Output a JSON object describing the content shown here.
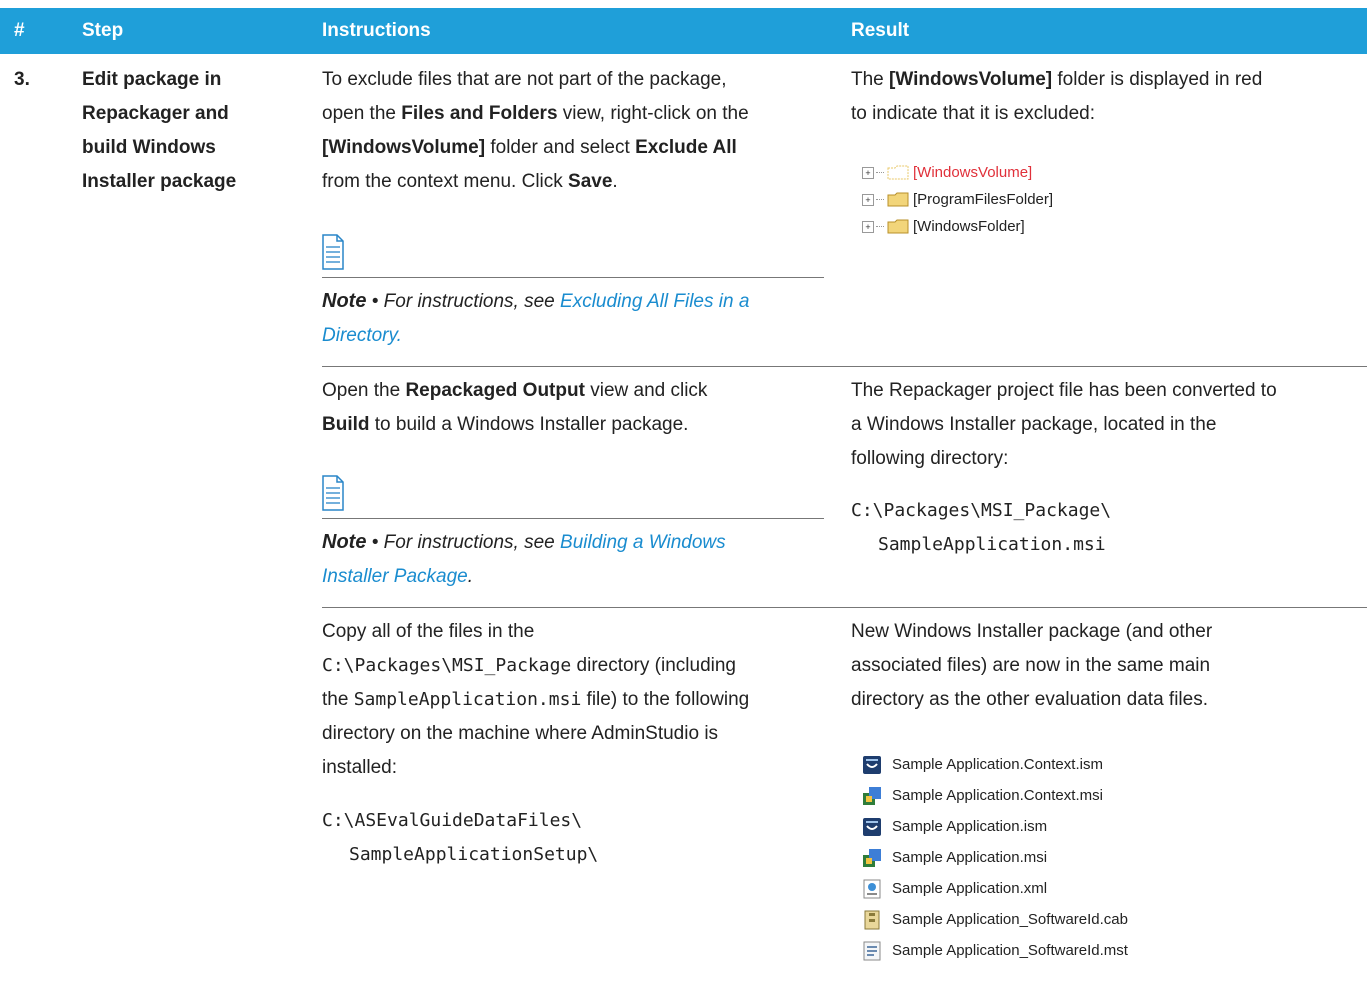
{
  "header": {
    "num": "#",
    "step": "Step",
    "instructions": "Instructions",
    "result": "Result"
  },
  "row1": {
    "number": "3.",
    "step": [
      "Edit package in",
      "Repackager and",
      "build Windows",
      "Installer package"
    ],
    "instr": {
      "l1": "To exclude files that are not part of the package,",
      "l2_a": "open the ",
      "l2_b": "Files and Folders",
      "l2_c": " view, right-click on the",
      "l3_a": "[WindowsVolume]",
      "l3_b": " folder and select ",
      "l3_c": "Exclude All",
      "l4_a": "from the context menu. Click ",
      "l4_b": "Save",
      "l4_c": "."
    },
    "note": {
      "label": "Note",
      "bullet": " • ",
      "text": "For instructions, see ",
      "link1": "Excluding All Files in a",
      "link2": "Directory.",
      "icon": "note-icon"
    },
    "result": {
      "l1_a": "The ",
      "l1_b": "[WindowsVolume]",
      "l1_c": " folder is displayed in red",
      "l2": "to indicate that it is excluded:"
    },
    "tree": [
      "[WindowsVolume]",
      "[ProgramFilesFolder]",
      "[WindowsFolder]"
    ]
  },
  "row2": {
    "instr": {
      "l1_a": "Open the ",
      "l1_b": "Repackaged Output",
      "l1_c": " view and click",
      "l2_a": "Build",
      "l2_b": " to build a Windows Installer package."
    },
    "note": {
      "label": "Note",
      "bullet": " • ",
      "text": "For instructions, see ",
      "link1": "Building a Windows",
      "link2": "Installer Package",
      "end": "."
    },
    "result": {
      "l1": "The Repackager project file has been converted to",
      "l2": "a Windows Installer package, located in the",
      "l3": "following directory:",
      "p1": "C:\\Packages\\MSI_Package\\",
      "p2": "SampleApplication.msi"
    }
  },
  "row3": {
    "instr": {
      "l1": "Copy all of the files in the",
      "l2_a": "C:\\Packages\\MSI_Package",
      "l2_b": " directory (including",
      "l3_a": "the ",
      "l3_b": "SampleApplication.msi",
      "l3_c": " file) to the following",
      "l4": "directory on the machine where AdminStudio is",
      "l5": "installed:",
      "p1": "C:\\ASEvalGuideDataFiles\\",
      "p2": "SampleApplicationSetup\\"
    },
    "result": {
      "l1": "New Windows Installer package (and other",
      "l2": "associated files) are now in the same main",
      "l3": "directory as the other evaluation data files."
    },
    "files": [
      "Sample Application.Context.ism",
      "Sample Application.Context.msi",
      "Sample Application.ism",
      "Sample Application.msi",
      "Sample Application.xml",
      "Sample Application_SoftwareId.cab",
      "Sample Application_SoftwareId.mst"
    ]
  },
  "colors": {
    "header_bg": "#1f9fd9",
    "link": "#1a8ccf",
    "excluded": "#e0303a"
  }
}
